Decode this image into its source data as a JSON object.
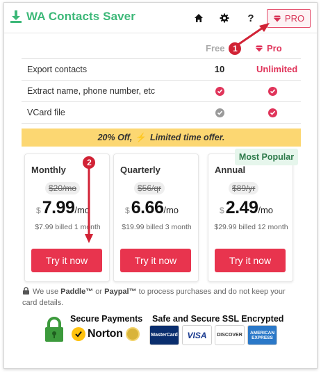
{
  "header": {
    "title": "WA Contacts Saver",
    "help_label": "?",
    "pro_label": "PRO",
    "icons": [
      "download-icon",
      "home-icon",
      "gear-icon",
      "help-icon",
      "gem-icon"
    ]
  },
  "comparison": {
    "free_label": "Free",
    "pro_label": "Pro",
    "rows": [
      {
        "feature": "Export contacts",
        "free": "10",
        "pro": "Unlimited"
      },
      {
        "feature": "Extract name, phone number, etc",
        "free": "check",
        "pro": "check"
      },
      {
        "feature": "VCard file",
        "free": "check-disabled",
        "pro": "check"
      }
    ]
  },
  "promo": {
    "left": "20% Off,",
    "bolt": "⚡",
    "right": "Limited time offer."
  },
  "badge": "Most Popular",
  "plans": [
    {
      "name": "Monthly",
      "old": "$20/mo",
      "currency": "$",
      "price": "7.99",
      "per": "/mo",
      "billed": "$7.99 billed 1 month",
      "cta": "Try it now"
    },
    {
      "name": "Quarterly",
      "old": "$56/qr",
      "currency": "$",
      "price": "6.66",
      "per": "/mo",
      "billed": "$19.99 billed 3 month",
      "cta": "Try it now"
    },
    {
      "name": "Annual",
      "old": "$89/yr",
      "currency": "$",
      "price": "2.49",
      "per": "/mo",
      "billed": "$29.99 billed 12 month",
      "cta": "Try it now"
    }
  ],
  "note": {
    "before": "We use ",
    "paddle": "Paddle™",
    "or": " or ",
    "paypal": "Paypal™",
    "after": " to process purchases and do not keep your card details."
  },
  "trust": {
    "secure": "Secure Payments",
    "ssl": "Safe and Secure SSL Encrypted",
    "norton": "Norton",
    "card_brands": [
      "MasterCard",
      "VISA",
      "DISCOVER",
      "AMERICAN EXPRESS"
    ]
  },
  "annotations": [
    "1",
    "2"
  ],
  "colors": {
    "brand": "#3cb878",
    "accent": "#e8344e",
    "promo": "#fcd772"
  }
}
